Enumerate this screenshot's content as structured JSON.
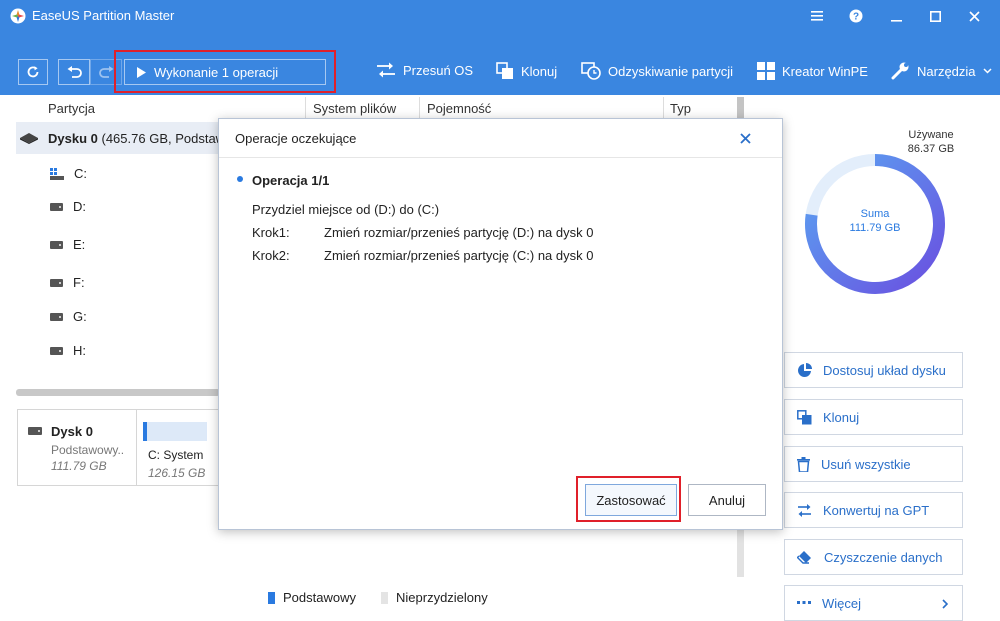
{
  "app": {
    "title": "EaseUS Partition Master"
  },
  "toolbar": {
    "execute_label": "Wykonanie 1 operacji",
    "tools": [
      {
        "label": "Przesuń OS",
        "icon": "migrate-os-icon"
      },
      {
        "label": "Klonuj",
        "icon": "clone-icon"
      },
      {
        "label": "Odzyskiwanie partycji",
        "icon": "partition-recovery-icon"
      },
      {
        "label": "Kreator WinPE",
        "icon": "windows-icon"
      },
      {
        "label": "Narzędzia",
        "icon": "wrench-icon"
      }
    ]
  },
  "table": {
    "headers": [
      "Partycja",
      "System plików",
      "Pojemność",
      "Typ"
    ],
    "disk_label": "Dysku 0",
    "disk_detail": "(465.76 GB, Podstaw",
    "partitions": [
      "C:",
      "D:",
      "E:",
      "F:",
      "G:",
      "H:"
    ]
  },
  "disk_card": {
    "name": "Dysk 0",
    "type": "Podstawowy..",
    "size": "111.79 GB",
    "partition_label": "C: System",
    "partition_size": "126.15 GB"
  },
  "legend": [
    {
      "label": "Podstawowy",
      "color": "#2a7ae0"
    },
    {
      "label": "Nieprzydzielony",
      "color": "#e4e4e4"
    }
  ],
  "usage": {
    "used_label": "Używane",
    "used_value": "86.37 GB",
    "total_label": "Suma",
    "total_value": "111.79 GB",
    "used_fraction": 0.773
  },
  "side_actions": [
    {
      "label": "Dostosuj układ dysku",
      "icon": "pie-chart-icon"
    },
    {
      "label": "Klonuj",
      "icon": "clone-icon"
    },
    {
      "label": "Usuń wszystkie",
      "icon": "trash-icon"
    },
    {
      "label": "Konwertuj na GPT",
      "icon": "convert-icon"
    },
    {
      "label": "Czyszczenie danych",
      "icon": "eraser-icon"
    },
    {
      "label": "Więcej",
      "icon": "more-icon"
    }
  ],
  "modal": {
    "title": "Operacje oczekujące",
    "operation_title": "Operacja 1/1",
    "summary": "Przydziel miejsce od (D:) do  (C:)",
    "steps": [
      {
        "label": "Krok1:",
        "text": "Zmień rozmiar/przenieś partycję (D:) na dysk  0"
      },
      {
        "label": "Krok2:",
        "text": "Zmień rozmiar/przenieś partycję  (C:) na dysk  0"
      }
    ],
    "apply_label": "Zastosować",
    "cancel_label": "Anuluj"
  }
}
